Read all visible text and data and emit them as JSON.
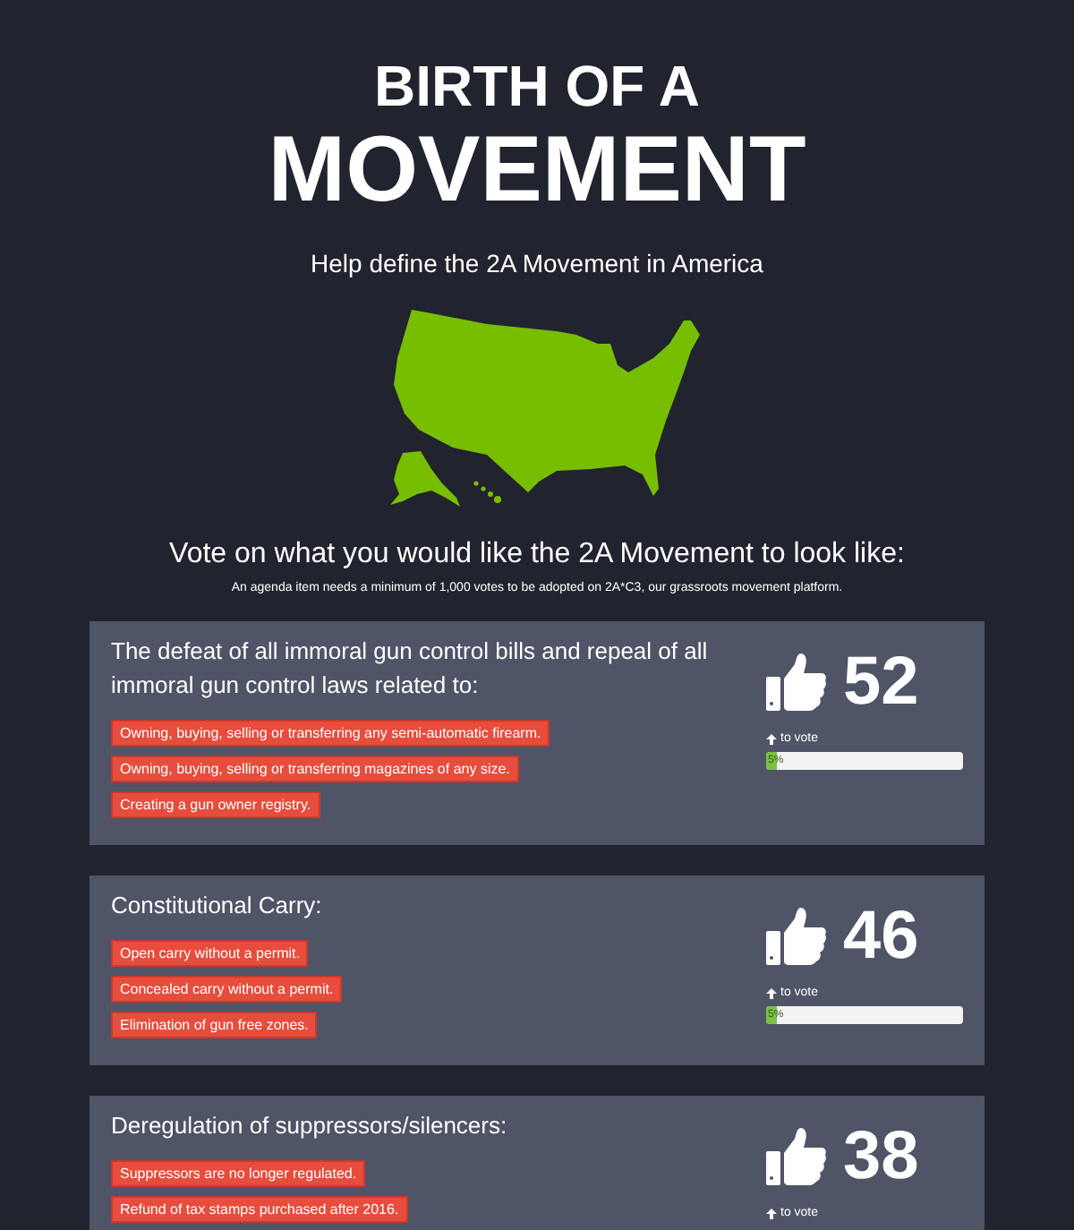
{
  "header": {
    "title_line_1": "BIRTH OF A",
    "title_line_2": "MOVEMENT",
    "subtitle": "Help define the 2A Movement in America"
  },
  "vote_section": {
    "heading": "Vote on what you would like the 2A Movement to look like:",
    "note": "An agenda item needs a minimum of 1,000 votes to be adopted on 2A*C3, our grassroots movement platform."
  },
  "agenda_items": [
    {
      "title": "The defeat of all immoral gun control bills and repeal of all immoral gun control laws related to:",
      "points": [
        "Owning, buying, selling or transferring any semi-automatic firearm.",
        "Owning, buying, selling or transferring magazines of any size.",
        "Creating a gun owner registry."
      ],
      "votes": "52",
      "vote_label": "to vote",
      "level": 0.05,
      "percent": "5%"
    },
    {
      "title": "Constitutional Carry:",
      "points": [
        "Open carry without a permit.",
        "Concealed carry without a permit.",
        "Elimination of gun free zones."
      ],
      "votes": "46",
      "vote_label": "to vote",
      "level": 0.05,
      "percent": "5%"
    },
    {
      "title": "Deregulation of suppressors/silencers:",
      "points": [
        "Suppressors are no longer regulated.",
        "Refund of tax stamps purchased after 2016."
      ],
      "votes": "38",
      "vote_label": "to vote"
    }
  ]
}
